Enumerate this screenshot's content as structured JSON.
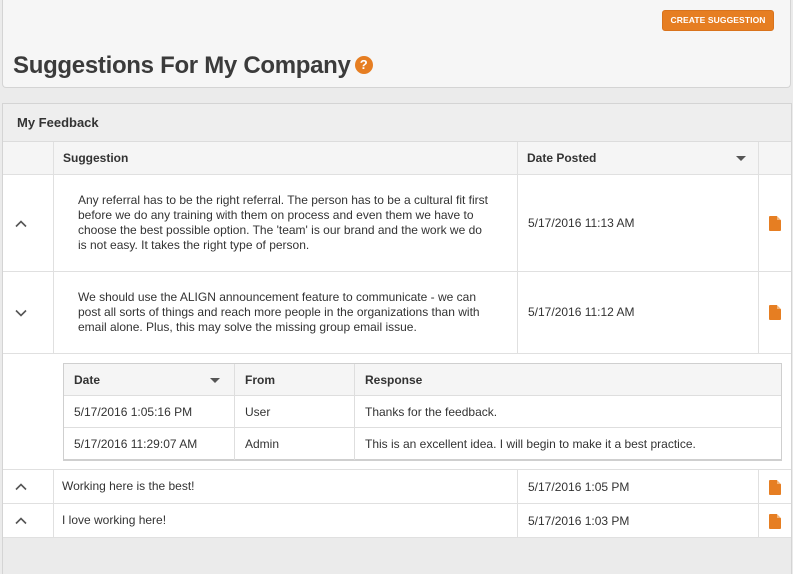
{
  "header": {
    "create_button": "CREATE SUGGESTION",
    "title": "Suggestions For My Company",
    "help_glyph": "?"
  },
  "panel": {
    "title": "My Feedback"
  },
  "grid": {
    "columns": [
      "",
      "Suggestion",
      "Date Posted",
      ""
    ],
    "rows": [
      {
        "expanded": false,
        "text": "Any referral has to be the right referral. The person has to be a cultural fit first before we do any training with them on process and even them we have to choose the best possible option. The 'team' is our brand and the work we do is not easy. It takes the right type of person.",
        "date": "5/17/2016 11:13 AM"
      },
      {
        "expanded": true,
        "text": "We should use the ALIGN announcement feature to communicate - we can post all sorts of things and reach more people in the organizations than with email alone. Plus, this may solve the missing group email issue.",
        "date": "5/17/2016 11:12 AM"
      },
      {
        "expanded": false,
        "text": "Working here is the best!",
        "date": "5/17/2016 1:05 PM"
      },
      {
        "expanded": false,
        "text": "I love working here!",
        "date": "5/17/2016 1:03 PM"
      }
    ]
  },
  "responses": {
    "columns": [
      "Date",
      "From",
      "Response"
    ],
    "rows": [
      {
        "date": "5/17/2016 1:05:16 PM",
        "from": "User",
        "response": "Thanks for the feedback."
      },
      {
        "date": "5/17/2016 11:29:07 AM",
        "from": "Admin",
        "response": "This is an excellent idea. I will begin to make it a best practice."
      }
    ]
  },
  "icons": {
    "help": "question-circle-icon",
    "collapse": "chevron-up-icon",
    "expand": "chevron-down-icon",
    "document": "document-icon",
    "sort": "caret-down-icon"
  },
  "colors": {
    "accent": "#e67e22",
    "panel_bg": "#ebebeb",
    "header_bg": "#f6f6f6"
  }
}
